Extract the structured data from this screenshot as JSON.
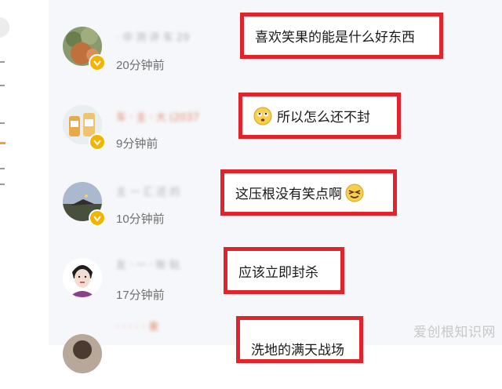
{
  "comments": [
    {
      "username_masked": "· 中 测 评 车 29",
      "time": "20分钟前",
      "text": "喜欢笑果的能是什么好东西",
      "emoji": ""
    },
    {
      "username_masked": "车 · 主 · 大 (2037",
      "time": "9分钟前",
      "text": "所以怎么还不封",
      "emoji": "eye-roll-emoji"
    },
    {
      "username_masked": "主 一 汇 还 的",
      "time": "10分钟前",
      "text": "这压根没有笑点啊",
      "emoji": "squint-emoji"
    },
    {
      "username_masked": "友 · 一 · 账 贴",
      "time": "17分钟前",
      "text": "应该立即封杀",
      "emoji": ""
    },
    {
      "username_masked": "· · · · · 東",
      "time": "",
      "text": "洗地的满天战场",
      "emoji": ""
    }
  ],
  "watermark": "爱创根知识网",
  "colors": {
    "highlight_border": "#e0242b",
    "badge": "#f3b400",
    "panel_bg": "#f6f7fa"
  }
}
